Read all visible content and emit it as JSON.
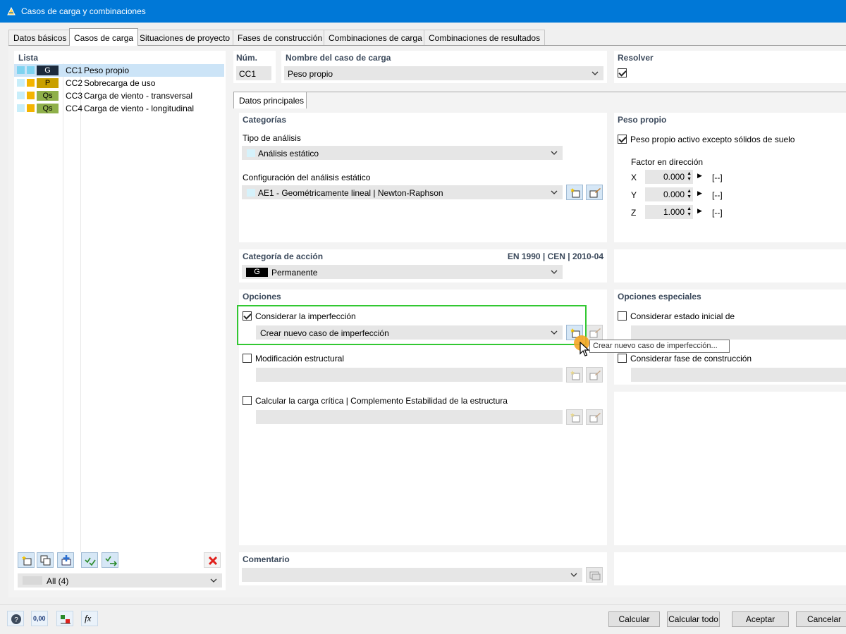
{
  "window": {
    "title": "Casos de carga y combinaciones",
    "icon": "app-icon"
  },
  "tabs": [
    {
      "label": "Datos básicos",
      "active": false
    },
    {
      "label": "Casos de carga",
      "active": true
    },
    {
      "label": "Situaciones de proyecto",
      "active": false
    },
    {
      "label": "Fases de construcción",
      "active": false
    },
    {
      "label": "Combinaciones de carga",
      "active": false
    },
    {
      "label": "Combinaciones de resultados",
      "active": false
    }
  ],
  "list": {
    "title": "Lista",
    "items": [
      {
        "tag": "G",
        "tag_color": "#1c2b3d",
        "tag_text_color": "#ffffff",
        "swatch1": "#7fd3f0",
        "swatch2": "#7fd3f0",
        "code": "CC1",
        "name": "Peso propio",
        "selected": true
      },
      {
        "tag": "P",
        "tag_color": "#c9a000",
        "tag_text_color": "#000000",
        "swatch1": "#c8eefa",
        "swatch2": "#f4b400",
        "code": "CC2",
        "name": "Sobrecarga de uso",
        "selected": false
      },
      {
        "tag": "Qs",
        "tag_color": "#8fb04a",
        "tag_text_color": "#000000",
        "swatch1": "#c8eefa",
        "swatch2": "#f4b400",
        "code": "CC3",
        "name": "Carga de viento - transversal",
        "selected": false
      },
      {
        "tag": "Qs",
        "tag_color": "#8fb04a",
        "tag_text_color": "#000000",
        "swatch1": "#c8eefa",
        "swatch2": "#f4b400",
        "code": "CC4",
        "name": "Carga de viento - longitudinal",
        "selected": false
      }
    ],
    "filter_value": "All (4)"
  },
  "header": {
    "num_label": "Núm.",
    "num_value": "CC1",
    "name_label": "Nombre del caso de carga",
    "name_value": "Peso propio",
    "resolver_label": "Resolver",
    "resolver_checked": true
  },
  "subtab": {
    "label": "Datos principales"
  },
  "categorias": {
    "title": "Categorías",
    "tipo_label": "Tipo de análisis",
    "tipo_value": "Análisis estático",
    "config_label": "Configuración del análisis estático",
    "config_value": "AE1 - Geométricamente lineal | Newton-Raphson"
  },
  "peso_propio": {
    "title": "Peso propio",
    "active_label": "Peso propio activo excepto sólidos de suelo",
    "active_checked": true,
    "factor_label": "Factor en dirección",
    "factors": [
      {
        "axis": "X",
        "value": "0.000",
        "unit": "[--]"
      },
      {
        "axis": "Y",
        "value": "0.000",
        "unit": "[--]"
      },
      {
        "axis": "Z",
        "value": "1.000",
        "unit": "[--]"
      }
    ]
  },
  "accion": {
    "title": "Categoría de acción",
    "norm": "EN 1990 | CEN | 2010-04",
    "tag": "G",
    "value": "Permanente"
  },
  "opciones": {
    "title": "Opciones",
    "imperfeccion_label": "Considerar la imperfección",
    "imperfeccion_checked": true,
    "imperfeccion_value": "Crear nuevo caso de imperfección",
    "modificacion_label": "Modificación estructural",
    "modificacion_checked": false,
    "carga_critica_label": "Calcular la carga crítica | Complemento Estabilidad de la estructura",
    "carga_critica_checked": false
  },
  "opciones_especiales": {
    "title": "Opciones especiales",
    "estado_inicial_label": "Considerar estado inicial de",
    "estado_inicial_checked": false,
    "fase_label": "Considerar fase de construcción",
    "fase_checked": false
  },
  "tooltip": "Crear nuevo caso de imperfección...",
  "comentario": {
    "title": "Comentario",
    "value": ""
  },
  "buttons": {
    "calcular": "Calcular",
    "calcular_todo": "Calcular todo",
    "aceptar": "Aceptar",
    "cancelar": "Cancelar"
  },
  "statusbar": {
    "units_icon_text": "0,00"
  },
  "colors": {
    "titlebar": "#0078d7",
    "highlight_frame": "#32c832",
    "selection": "#cce4f7",
    "section_title": "#3c4a5c",
    "delete_red": "#e0201b",
    "cursor_halo": "#f5a623"
  }
}
